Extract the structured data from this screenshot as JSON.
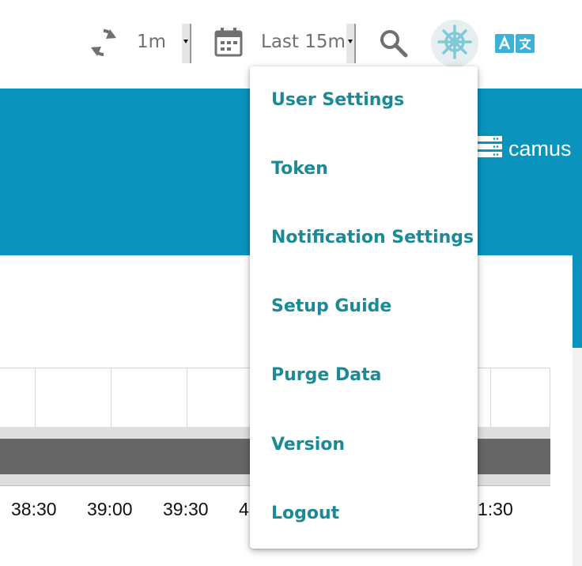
{
  "toolbar": {
    "refresh_interval": "1m",
    "time_range": "Last 15m",
    "icons": {
      "refresh": "refresh-icon",
      "calendar": "calendar-icon",
      "search": "search-icon",
      "helm": "helm-icon",
      "translate": "translate-icon",
      "server": "server-icon"
    }
  },
  "brand": {
    "label": "camus"
  },
  "user_menu": {
    "items": [
      "User Settings",
      "Token",
      "Notification Settings",
      "Setup Guide",
      "Purge Data",
      "Version",
      "Logout"
    ]
  },
  "timeline": {
    "tick_labels": [
      "38:30",
      "39:00",
      "39:30",
      "4",
      "1:30"
    ]
  },
  "colors": {
    "header_blue": "#0a93bd",
    "menu_text": "#1a8b96",
    "icon_gray": "#707070",
    "helm_icon": "#7fcad6"
  }
}
